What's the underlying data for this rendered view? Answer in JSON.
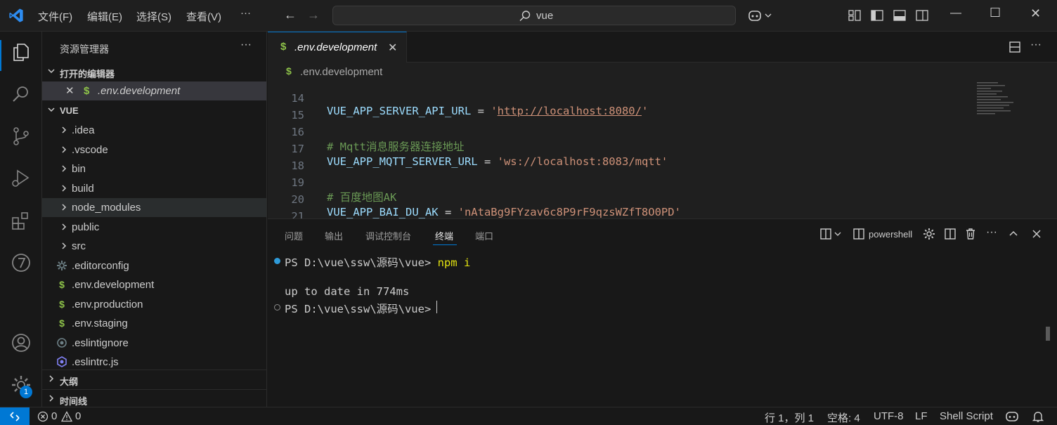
{
  "titlebar": {
    "menus": [
      "文件(F)",
      "编辑(E)",
      "选择(S)",
      "查看(V)",
      "···"
    ],
    "search_text": "vue"
  },
  "sidebar": {
    "title": "资源管理器",
    "more": "···",
    "open_editors_label": "打开的编辑器",
    "open_editor_file": ".env.development",
    "project_label": "VUE",
    "folders": [
      ".idea",
      ".vscode",
      "bin",
      "build",
      "node_modules",
      "public",
      "src"
    ],
    "files": [
      {
        "name": ".editorconfig",
        "icon": "gear-icon"
      },
      {
        "name": ".env.development",
        "icon": "dollar-icon"
      },
      {
        "name": ".env.production",
        "icon": "dollar-icon"
      },
      {
        "name": ".env.staging",
        "icon": "dollar-icon"
      },
      {
        "name": ".eslintignore",
        "icon": "eslint-icon"
      },
      {
        "name": ".eslintrc.js",
        "icon": "eslint-icon"
      }
    ],
    "outline_label": "大纲",
    "timeline_label": "时间线"
  },
  "activity": {
    "badge": "1"
  },
  "editor": {
    "tab_label": ".env.development",
    "breadcrumb": ".env.development",
    "lines": [
      {
        "n": "14",
        "key": "VUE_APP_SERVER_API_URL",
        "op": " = ",
        "val": "'http://localhost:8080/'",
        "link": "http://localhost:8080/"
      },
      {
        "n": "15"
      },
      {
        "n": "16",
        "comment": "# Mqtt消息服务器连接地址"
      },
      {
        "n": "17",
        "key": "VUE_APP_MQTT_SERVER_URL",
        "op": " = ",
        "val": "'ws://localhost:8083/mqtt'"
      },
      {
        "n": "18"
      },
      {
        "n": "19",
        "comment": "# 百度地图AK"
      },
      {
        "n": "20",
        "key": "VUE_APP_BAI_DU_AK",
        "op": " = ",
        "val": "'nAtaBg9FYzav6c8P9rF9qzsWZfT8O0PD'"
      },
      {
        "n": "21"
      }
    ]
  },
  "panel": {
    "tabs": [
      "问题",
      "输出",
      "调试控制台",
      "终端",
      "端口"
    ],
    "active_tab": "终端",
    "shell": "powershell",
    "terminal": {
      "prompt1": "PS D:\\vue\\ssw\\源码\\vue> ",
      "cmd1": "npm i",
      "output": "up to date in 774ms",
      "prompt2": "PS D:\\vue\\ssw\\源码\\vue> "
    }
  },
  "statusbar": {
    "errors": "0",
    "warnings": "0",
    "position": "行 1，列 1",
    "spaces": "空格: 4",
    "encoding": "UTF-8",
    "eol": "LF",
    "language": "Shell Script"
  }
}
